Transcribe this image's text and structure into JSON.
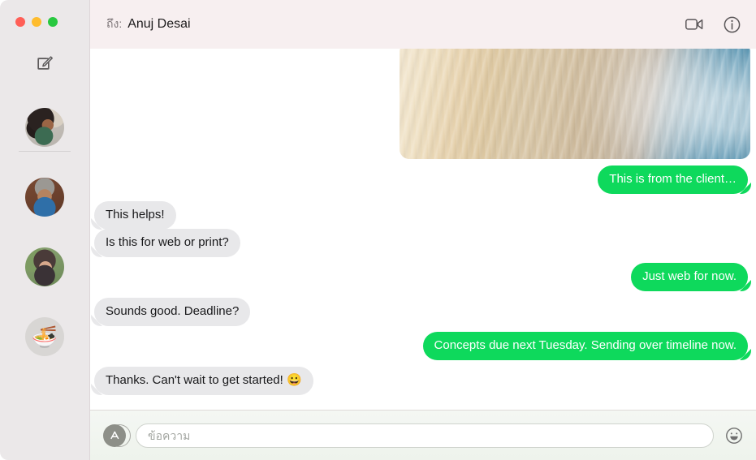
{
  "window": {
    "traffic_lights": [
      {
        "name": "close",
        "color": "#ff5f57"
      },
      {
        "name": "minimize",
        "color": "#febc2e"
      },
      {
        "name": "zoom",
        "color": "#28c840"
      }
    ]
  },
  "sidebar": {
    "compose_icon": "compose-icon",
    "conversations": [
      {
        "name": "conversation-avatar-1",
        "avatar": "person-afro-green-shirt"
      },
      {
        "name": "conversation-avatar-2",
        "avatar": "person-gray-hair-blue-top"
      },
      {
        "name": "conversation-avatar-3",
        "avatar": "person-dark-hair-outdoors"
      },
      {
        "name": "conversation-avatar-4",
        "avatar": "🍜"
      }
    ]
  },
  "header": {
    "to_label": "ถึง:",
    "recipient": "Anuj Desai",
    "video_icon": "video-camera-icon",
    "info_icon": "info-icon"
  },
  "transcript": {
    "attachment": {
      "name": "photo-attachment",
      "description": "blonde hair photo"
    },
    "messages": [
      {
        "id": "m1",
        "text": "This is from the client…",
        "direction": "out"
      },
      {
        "id": "m2",
        "text": "This helps!",
        "direction": "in"
      },
      {
        "id": "m3",
        "text": "Is this for web or print?",
        "direction": "in"
      },
      {
        "id": "m4",
        "text": "Just web for now.",
        "direction": "out"
      },
      {
        "id": "m5",
        "text": "Sounds good. Deadline?",
        "direction": "in"
      },
      {
        "id": "m6",
        "text": "Concepts due next Tuesday. Sending over timeline now.",
        "direction": "out"
      },
      {
        "id": "m7",
        "text": "Thanks. Can't wait to get started! 😀",
        "direction": "in"
      }
    ]
  },
  "composer": {
    "apps_icon": "app-store-icon",
    "input_value": "",
    "input_placeholder": "ข้อความ",
    "emoji_icon": "smiley-face-icon"
  },
  "colors": {
    "outgoing_bubble": "#0ed95c",
    "incoming_bubble": "#e8e8ea",
    "sidebar_bg": "#ebe8e9",
    "titlebar_bg": "#f7eff0"
  }
}
